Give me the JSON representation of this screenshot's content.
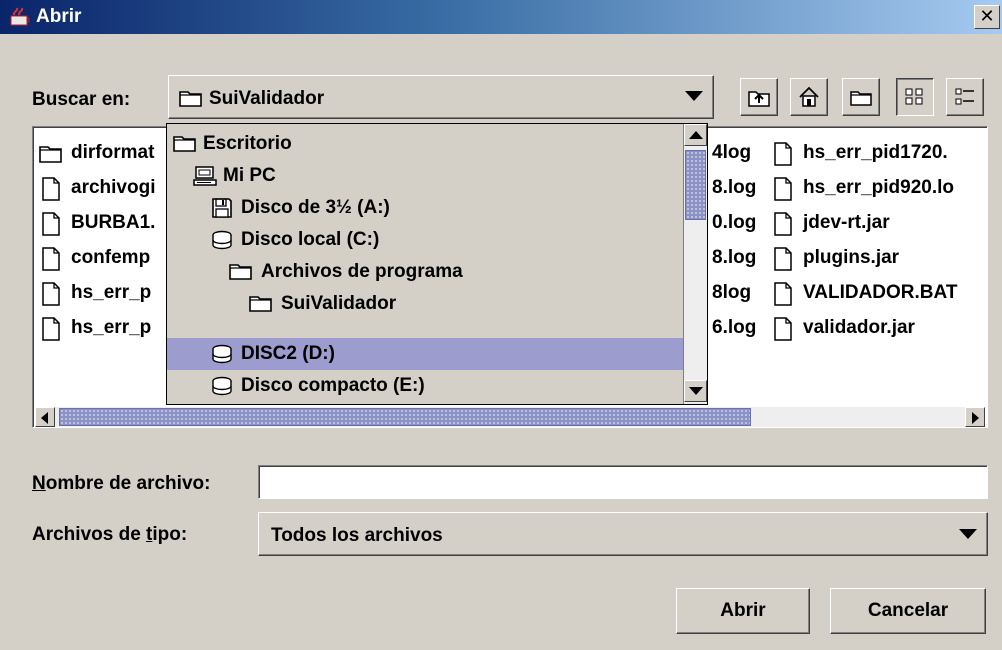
{
  "window": {
    "title": "Abrir",
    "close_glyph": "✕"
  },
  "lookin": {
    "label": "Buscar en:",
    "selected": "SuiValidador"
  },
  "toolbar": {
    "icons": [
      "up-one-level-icon",
      "home-icon",
      "new-folder-icon",
      "list-view-icon",
      "details-view-icon"
    ],
    "active_view": "list-view"
  },
  "files": {
    "column1": [
      {
        "name": "dirformat",
        "icon": "folder-icon"
      },
      {
        "name": "archivogi",
        "icon": "file-icon"
      },
      {
        "name": "BURBA1.",
        "icon": "file-icon"
      },
      {
        "name": "confemp",
        "icon": "file-icon"
      },
      {
        "name": "hs_err_p",
        "icon": "file-icon"
      },
      {
        "name": "hs_err_p",
        "icon": "file-icon"
      }
    ],
    "column3": [
      "4log",
      "8.log",
      "0.log",
      "8.log",
      "8log",
      "6.log"
    ],
    "column4": [
      {
        "name": "hs_err_pid1720.",
        "icon": "file-icon"
      },
      {
        "name": "hs_err_pid920.lo",
        "icon": "file-icon"
      },
      {
        "name": "jdev-rt.jar",
        "icon": "file-icon"
      },
      {
        "name": "plugins.jar",
        "icon": "file-icon"
      },
      {
        "name": "VALIDADOR.BAT",
        "icon": "file-icon"
      },
      {
        "name": "validador.jar",
        "icon": "file-icon"
      }
    ]
  },
  "dropdown": {
    "items": [
      {
        "label": "Escritorio",
        "icon": "folder-icon",
        "level": 0,
        "selected": false
      },
      {
        "label": "Mi PC",
        "icon": "computer-icon",
        "level": 1,
        "selected": false
      },
      {
        "label": "Disco de 3½ (A:)",
        "icon": "floppy-icon",
        "level": 2,
        "selected": false
      },
      {
        "label": "Disco local (C:)",
        "icon": "disk-icon",
        "level": 2,
        "selected": false
      },
      {
        "label": "Archivos de programa",
        "icon": "folder-icon",
        "level": 3,
        "selected": false
      },
      {
        "label": "SuiValidador",
        "icon": "folder-icon",
        "level": 4,
        "selected": false
      },
      {
        "label": "DISC2 (D:)",
        "icon": "disk-icon",
        "level": 2,
        "selected": true
      },
      {
        "label": "Disco compacto (E:)",
        "icon": "disk-icon",
        "level": 2,
        "selected": false
      }
    ]
  },
  "filename": {
    "label_mnemonic": "N",
    "label_rest": "ombre de archivo:",
    "value": ""
  },
  "filetype": {
    "label_before": "Archivos de ",
    "label_mnemonic": "t",
    "label_after": "ipo:",
    "selected": "Todos los archivos"
  },
  "buttons": {
    "open": "Abrir",
    "cancel": "Cancelar"
  },
  "colors": {
    "titlebar_start": "#0a246a",
    "selection": "#9c9ccf",
    "scroll_thumb": "#8c92c4",
    "face": "#d4d0c8"
  }
}
